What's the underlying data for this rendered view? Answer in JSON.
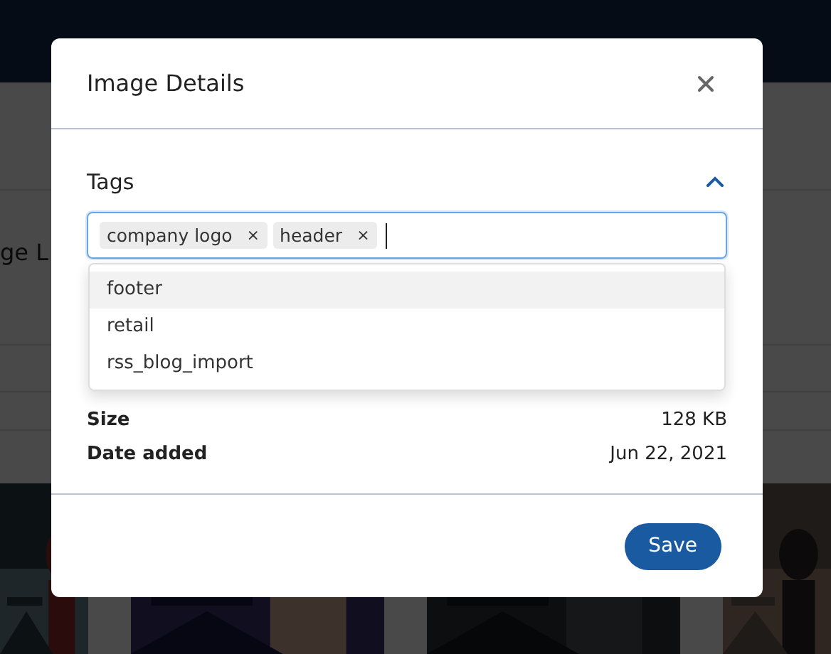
{
  "background": {
    "heading_fragment": "ge L"
  },
  "dialog": {
    "title": "Image Details",
    "tags_section": {
      "label": "Tags",
      "expanded": true,
      "tags": [
        {
          "label": "company logo",
          "remove": "×"
        },
        {
          "label": "header",
          "remove": "×"
        }
      ],
      "suggestions": [
        {
          "label": "footer",
          "selected": true
        },
        {
          "label": "retail",
          "selected": false
        },
        {
          "label": "rss_blog_import",
          "selected": false
        }
      ]
    },
    "details": [
      {
        "label": "Size",
        "value": "128 KB"
      },
      {
        "label": "Date added",
        "value": "Jun 22, 2021"
      }
    ],
    "buttons": [
      {
        "label": "Save"
      }
    ]
  }
}
